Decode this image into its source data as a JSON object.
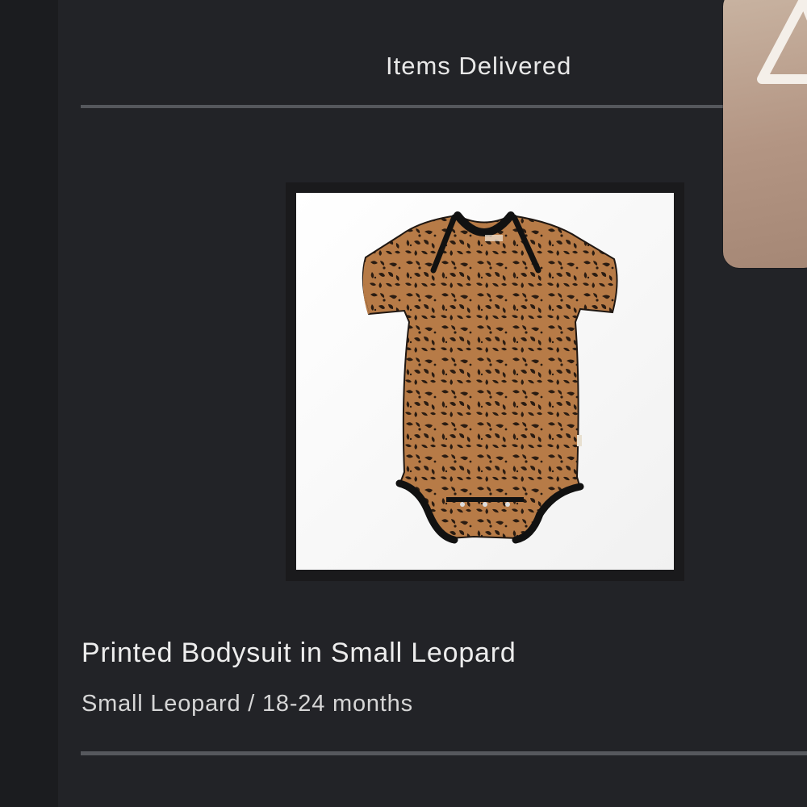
{
  "section": {
    "title": "Items Delivered"
  },
  "item": {
    "name": "Printed Bodysuit in Small Leopard",
    "variant": "Small Leopard / 18-24 months",
    "image_icon": "leopard-bodysuit-image"
  },
  "peek_card": {
    "icon": "triangle-outline-icon"
  },
  "colors": {
    "background": "#222327",
    "divider": "#55575c",
    "fabric": "#b57a46",
    "trim": "#111111"
  }
}
